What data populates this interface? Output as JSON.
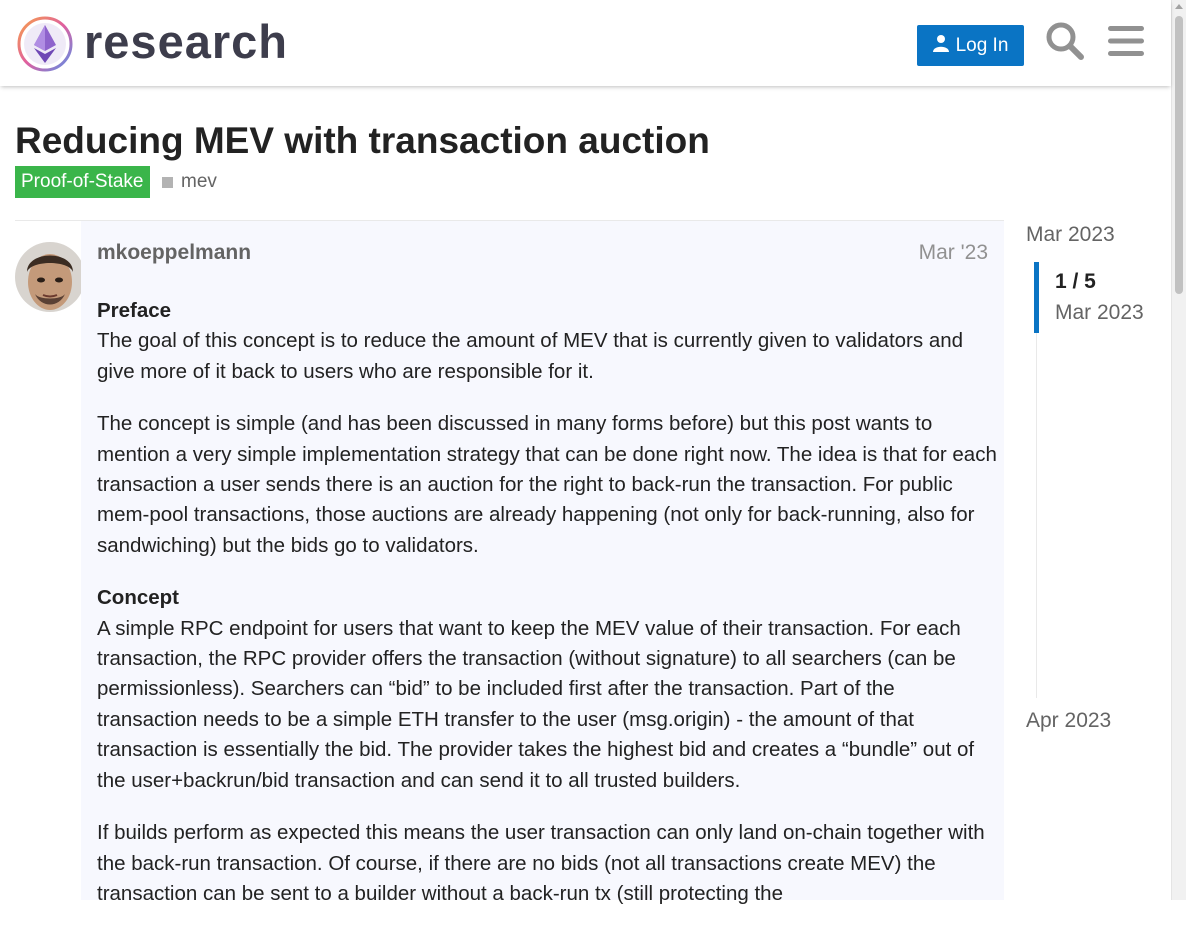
{
  "header": {
    "site_name": "research",
    "login_label": "Log In",
    "brand_color": "#0a74c4",
    "icons": [
      "logo-icon",
      "user-icon",
      "search-icon",
      "hamburger-menu-icon"
    ]
  },
  "topic": {
    "title": "Reducing MEV with transaction auction",
    "category": {
      "label": "Proof-of-Stake",
      "color": "#3ab54a"
    },
    "tags": [
      {
        "label": "mev",
        "color": "#b3b3b3"
      }
    ]
  },
  "post": {
    "author": "mkoeppelmann",
    "date": "Mar '23",
    "sections": [
      {
        "heading": "Preface",
        "paragraphs": [
          "The goal of this concept is to reduce the amount of MEV that is currently given to validators and give more of it back to users who are responsible for it."
        ]
      },
      {
        "paragraphs": [
          "The concept is simple (and has been discussed in many forms before) but this post wants to mention a very simple implementation strategy that can be done right now. The idea is that for each transaction a user sends there is an auction for the right to back-run the transaction. For public mem-pool transactions, those auctions are already happening (not only for back-running, also for sandwiching) but the bids go to validators."
        ]
      },
      {
        "heading": "Concept",
        "paragraphs": [
          "A simple RPC endpoint for users that want to keep the MEV value of their transaction. For each transaction, the RPC provider offers the transaction (without signature) to all searchers (can be permissionless). Searchers can “bid” to be included first after the transaction. Part of the transaction needs to be a simple ETH transfer to the user (msg.origin) - the amount of that transaction is essentially the bid. The provider takes the highest bid and creates a “bundle” out of the user+backrun/bid transaction and can send it to all trusted builders."
        ]
      },
      {
        "paragraphs": [
          "If builds perform as expected this means the user transaction can only land on-chain together with the back-run transaction. Of course, if there are no bids (not all transactions create MEV) the transaction can be sent to a builder without a back-run tx (still protecting the"
        ]
      }
    ]
  },
  "timeline": {
    "start_label": "Mar 2023",
    "position": "1 / 5",
    "position_date": "Mar 2023",
    "end_label": "Apr 2023"
  }
}
